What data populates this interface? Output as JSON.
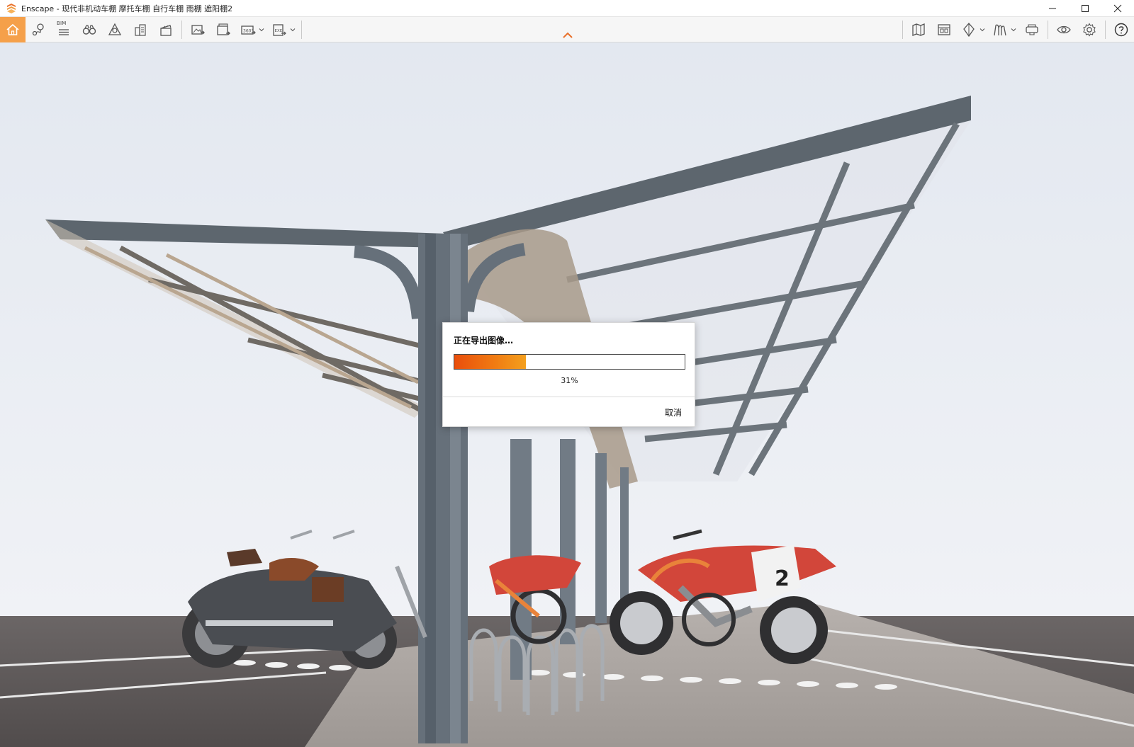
{
  "window": {
    "title": "Enscape - 现代非机动车棚 摩托车棚 自行车棚 雨棚 遮阳棚2"
  },
  "toolbar": {
    "bim_label": "BIM",
    "left_icons": [
      "home-icon",
      "location-pin-icon",
      "bim-list-icon",
      "binoculars-icon",
      "visual-settings-icon",
      "buildings-icon",
      "clapper-icon",
      "screenshot-export-icon",
      "batch-export-icon",
      "panorama-360-icon",
      "exe-export-icon"
    ],
    "right_icons": [
      "map-icon",
      "asset-library-icon",
      "view-cube-icon",
      "sketch-icon",
      "vr-headset-icon",
      "eye-icon",
      "gear-icon",
      "help-icon"
    ],
    "tb_360": "360°",
    "tb_exe": "EXE"
  },
  "dialog": {
    "title": "正在导出图像…",
    "progress": 31,
    "progress_label": "31%",
    "cancel_label": "取消"
  },
  "colors": {
    "accent": "#f5a04a",
    "progress_start": "#e94e0c",
    "progress_end": "#f4a01e"
  }
}
